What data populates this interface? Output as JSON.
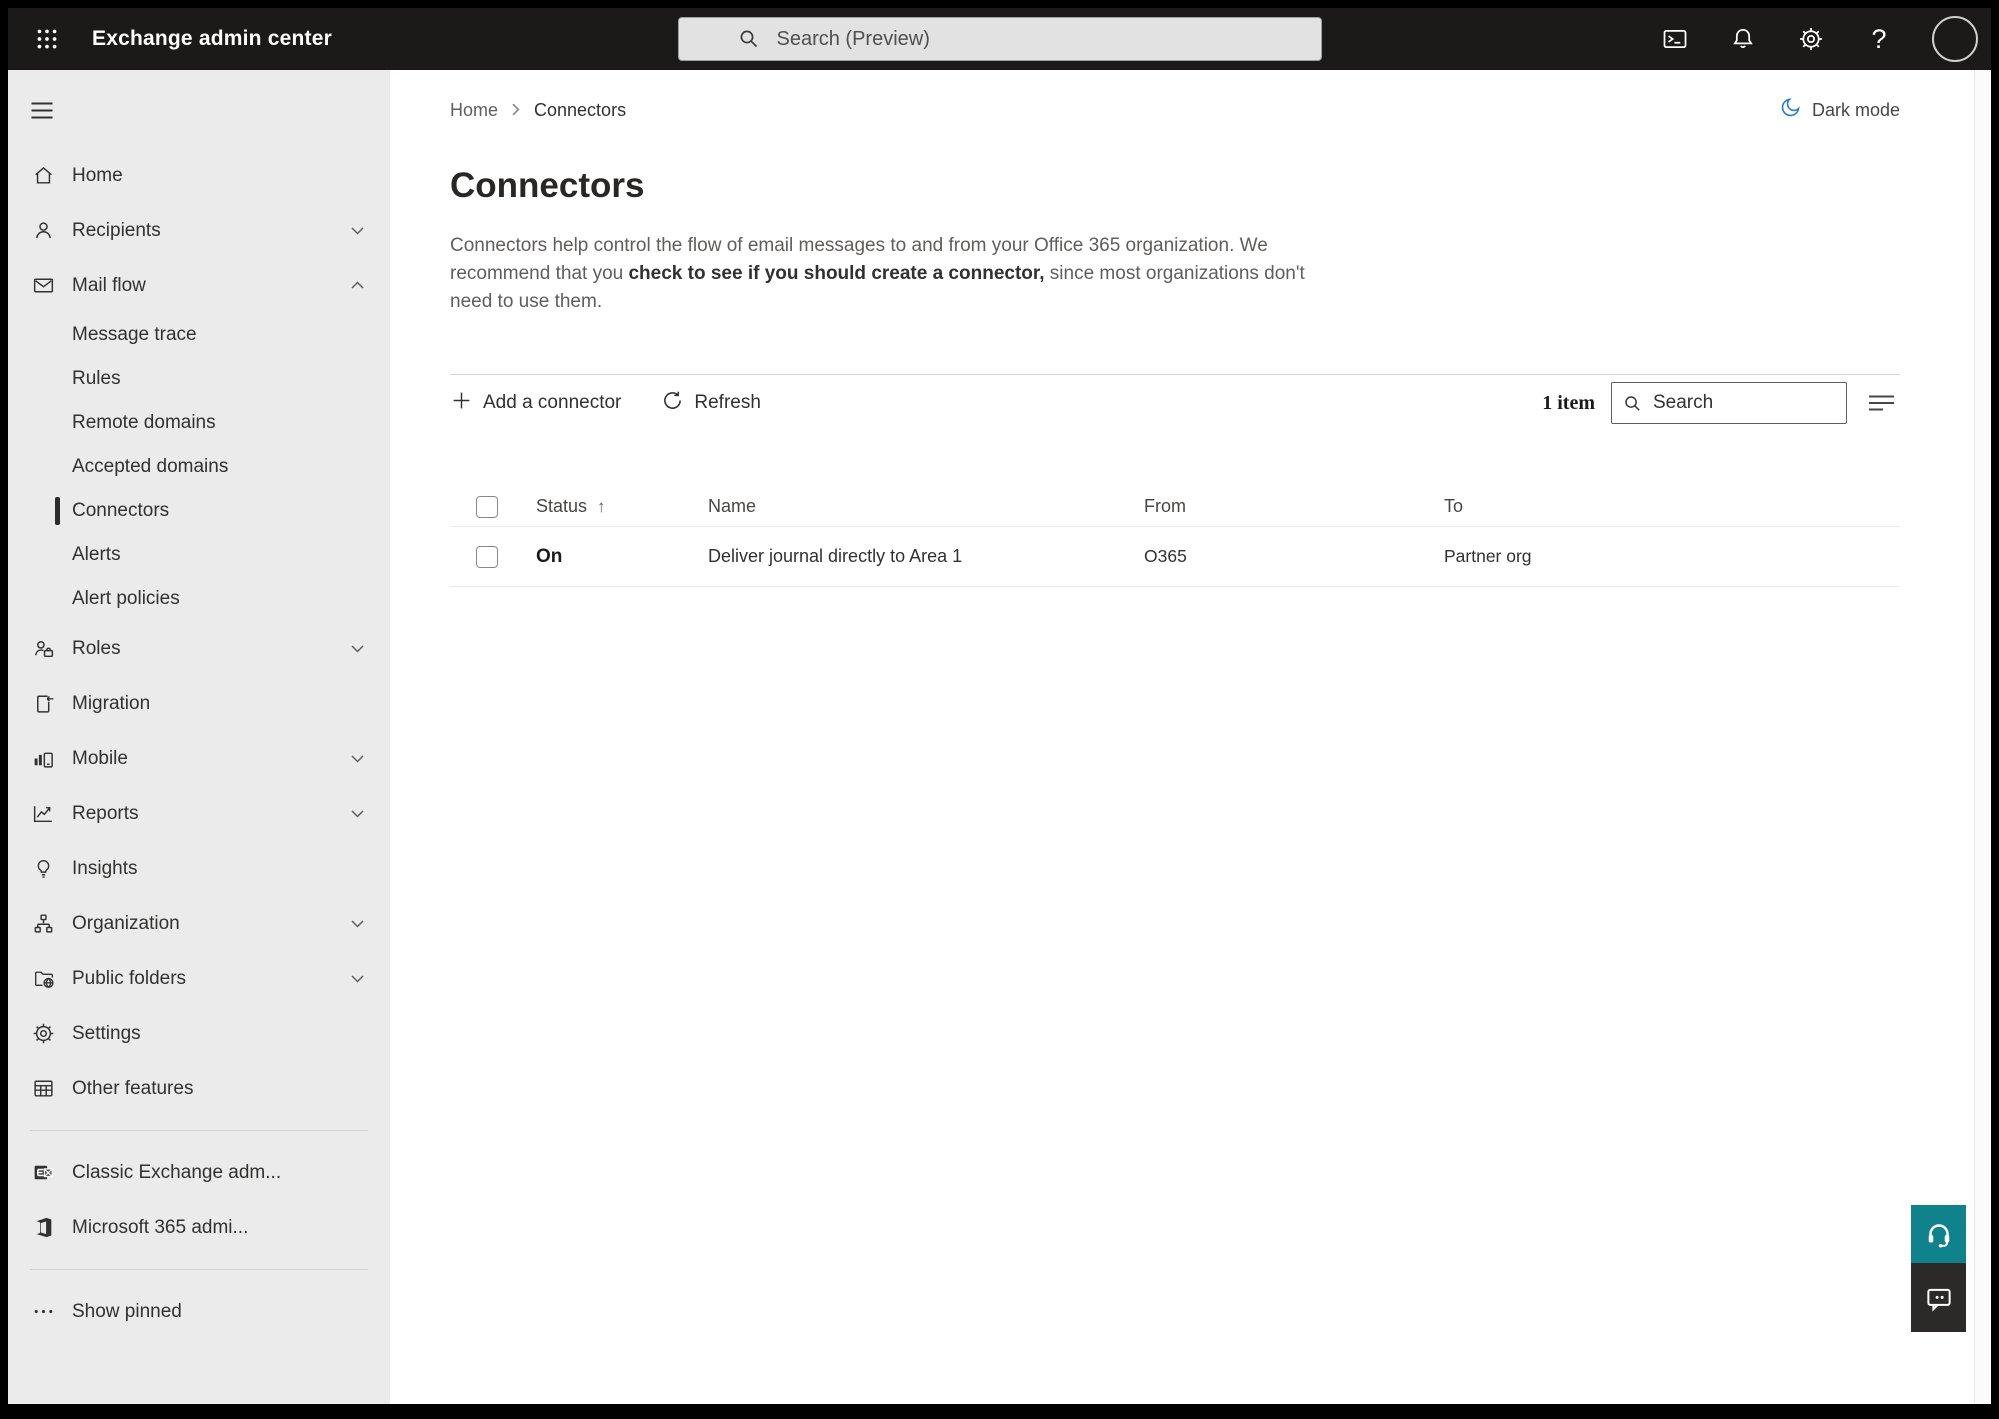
{
  "colors": {
    "topbar_bg": "#1b1a19",
    "sidebar_bg": "#ebebeb",
    "accent_teal": "#0f828c",
    "moon_blue": "#2b7cd3",
    "selected_indicator": "#2b2b2b"
  },
  "topbar": {
    "app_title": "Exchange admin center",
    "search_placeholder": "Search (Preview)",
    "help_label": "?"
  },
  "sidebar": {
    "items": [
      {
        "label": "Home"
      },
      {
        "label": "Recipients"
      },
      {
        "label": "Mail flow"
      },
      {
        "label": "Message trace"
      },
      {
        "label": "Rules"
      },
      {
        "label": "Remote domains"
      },
      {
        "label": "Accepted domains"
      },
      {
        "label": "Connectors"
      },
      {
        "label": "Alerts"
      },
      {
        "label": "Alert policies"
      },
      {
        "label": "Roles"
      },
      {
        "label": "Migration"
      },
      {
        "label": "Mobile"
      },
      {
        "label": "Reports"
      },
      {
        "label": "Insights"
      },
      {
        "label": "Organization"
      },
      {
        "label": "Public folders"
      },
      {
        "label": "Settings"
      },
      {
        "label": "Other features"
      }
    ],
    "footer_items": [
      {
        "label": "Classic Exchange adm..."
      },
      {
        "label": "Microsoft 365 admi..."
      }
    ],
    "show_pinned_label": "Show pinned"
  },
  "breadcrumb": {
    "home": "Home",
    "current": "Connectors"
  },
  "header": {
    "dark_mode_label": "Dark mode"
  },
  "page": {
    "title": "Connectors",
    "description_part1": "Connectors help control the flow of email messages to and from your Office 365 organization. We recommend that you ",
    "description_link": "check to see if you should create a connector,",
    "description_part2": " since most organizations don't need to use them."
  },
  "toolbar": {
    "add_label": "Add a connector",
    "refresh_label": "Refresh",
    "item_count": "1 item",
    "search_placeholder": "Search"
  },
  "table": {
    "columns": [
      "Status",
      "Name",
      "From",
      "To"
    ],
    "sort_icon": "↑",
    "rows": [
      {
        "status": "On",
        "name": "Deliver journal directly to Area 1",
        "from": "O365",
        "to": "Partner org"
      }
    ]
  }
}
